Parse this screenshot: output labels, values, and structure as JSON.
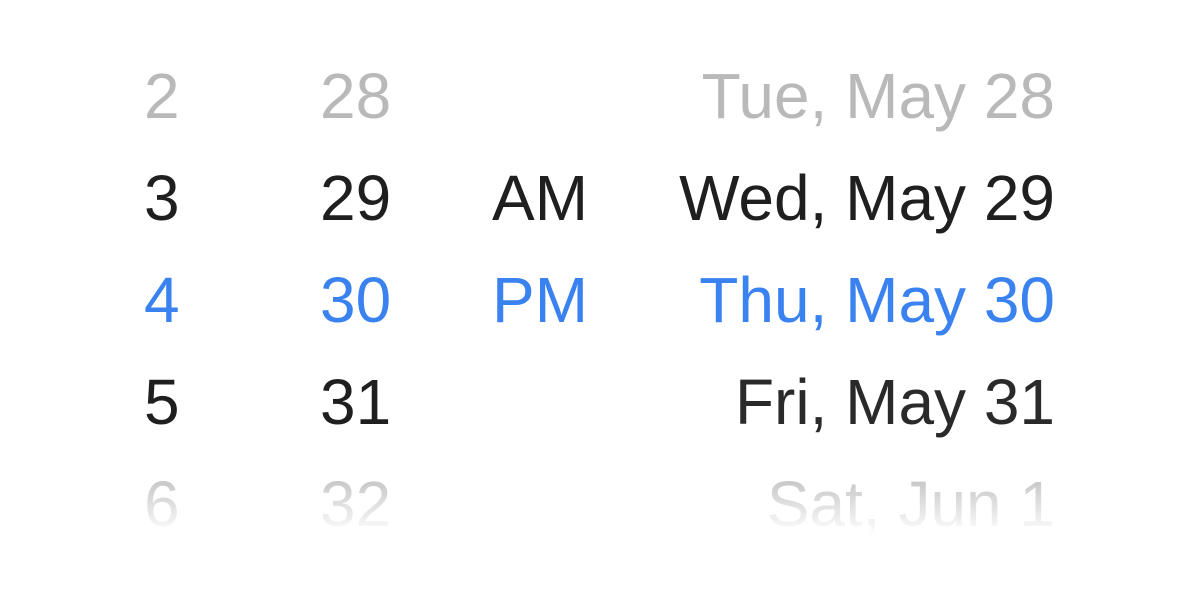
{
  "picker": {
    "hours": [
      {
        "label": "2",
        "state": "faded"
      },
      {
        "label": "3",
        "state": "normal"
      },
      {
        "label": "4",
        "state": "selected"
      },
      {
        "label": "5",
        "state": "normal"
      },
      {
        "label": "6",
        "state": "faded"
      }
    ],
    "minutes": [
      {
        "label": "28",
        "state": "faded"
      },
      {
        "label": "29",
        "state": "normal"
      },
      {
        "label": "30",
        "state": "selected"
      },
      {
        "label": "31",
        "state": "normal"
      },
      {
        "label": "32",
        "state": "faded"
      }
    ],
    "ampm": [
      {
        "label": "AM",
        "state": "normal"
      },
      {
        "label": "PM",
        "state": "selected"
      }
    ],
    "dates": [
      {
        "label": "Tue, May 28",
        "state": "faded"
      },
      {
        "label": "Wed, May 29",
        "state": "normal"
      },
      {
        "label": "Thu, May 30",
        "state": "selected"
      },
      {
        "label": "Fri, May 31",
        "state": "normal"
      },
      {
        "label": "Sat, Jun 1",
        "state": "faded"
      }
    ],
    "colors": {
      "selected": "#3b82f1",
      "normal": "#1f1f1f",
      "faded": "#b9b9b9"
    }
  }
}
